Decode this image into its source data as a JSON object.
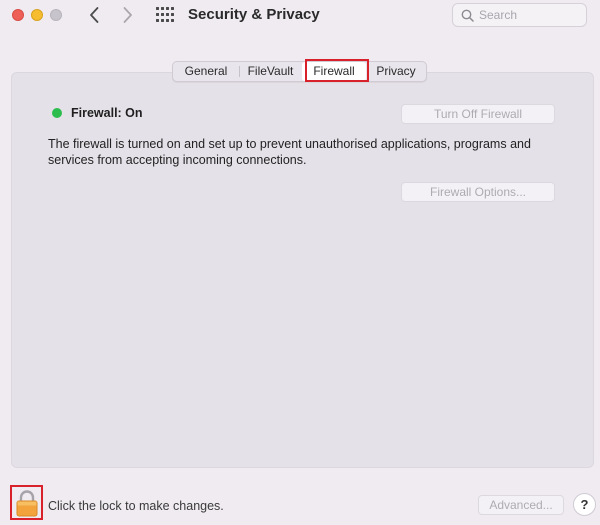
{
  "window": {
    "title": "Security & Privacy"
  },
  "search": {
    "placeholder": "Search",
    "value": ""
  },
  "tabs": [
    {
      "label": "General",
      "selected": false
    },
    {
      "label": "FileVault",
      "selected": false
    },
    {
      "label": "Firewall",
      "selected": true
    },
    {
      "label": "Privacy",
      "selected": false
    }
  ],
  "firewall": {
    "status_label": "Firewall: On",
    "status_color": "#2dbd4e",
    "turn_off_label": "Turn Off Firewall",
    "description": "The firewall is turned on and set up to prevent unauthorised applications, programs and services from accepting incoming connections.",
    "options_label": "Firewall Options..."
  },
  "footer": {
    "lock_text": "Click the lock to make changes.",
    "advanced_label": "Advanced...",
    "help_label": "?"
  },
  "colors": {
    "highlight": "#d8212a",
    "close": "#ee5f57",
    "minimize": "#f5bd2f",
    "lock": "#f2a33c"
  },
  "icons": {
    "back": "chevron-left-icon",
    "forward": "chevron-right-icon",
    "grid": "grid-icon",
    "search": "search-icon",
    "lock": "lock-icon",
    "status": "status-dot-icon"
  }
}
